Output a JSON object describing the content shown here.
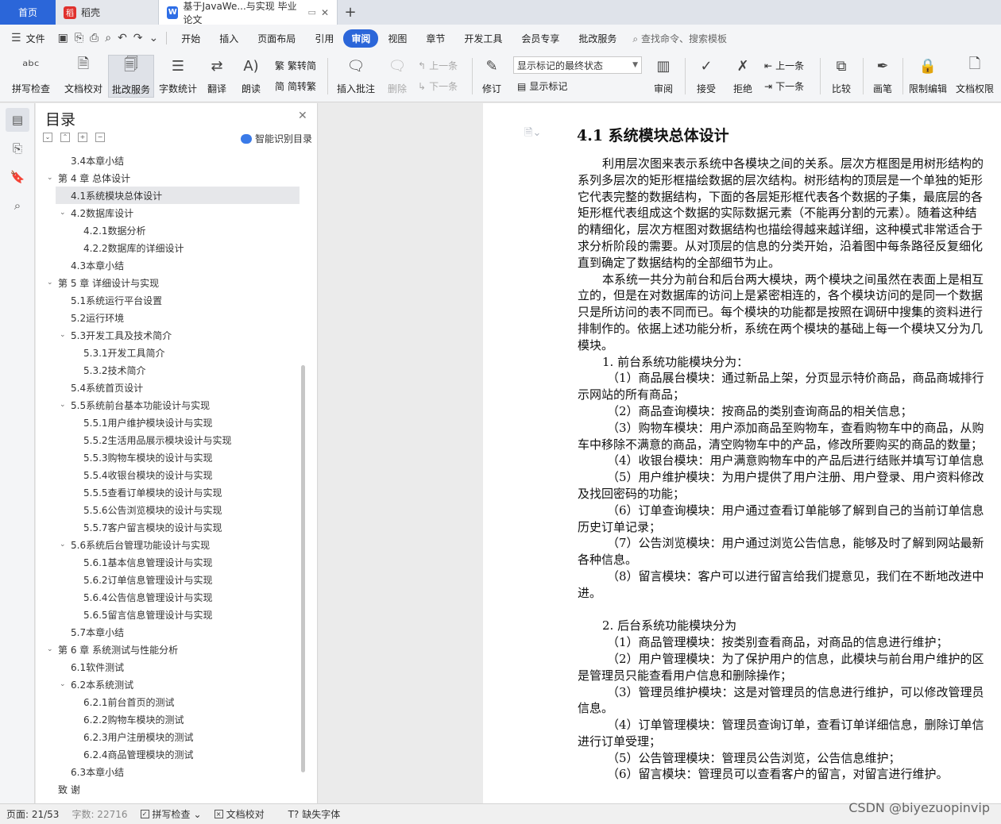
{
  "tabs": {
    "home": "首页",
    "daoke": "稻壳",
    "doc_title": "基于JavaWe...与实现 毕业论文",
    "plus": "+"
  },
  "menu": {
    "file": "文件",
    "items": [
      "开始",
      "插入",
      "页面布局",
      "引用",
      "审阅",
      "视图",
      "章节",
      "开发工具",
      "会员专享",
      "批改服务"
    ],
    "active": "审阅",
    "search": "查找命令、搜索模板"
  },
  "ribbon": {
    "spell_check": "拼写检查",
    "doc_proof": "文档校对",
    "review_service": "批改服务",
    "word_count": "字数统计",
    "translate": "翻译",
    "read_aloud": "朗读",
    "to_traditional": "繁转简",
    "to_simplified": "简转繁",
    "insert_comment": "插入批注",
    "delete": "删除",
    "prev": "上一条",
    "next": "下一条",
    "revise": "修订",
    "markup_select": "显示标记的最终状态",
    "show_markup": "显示标记",
    "review": "审阅",
    "accept": "接受",
    "reject": "拒绝",
    "prev2": "上一条",
    "next2": "下一条",
    "compare": "比较",
    "pen": "画笔",
    "restrict_edit": "限制编辑",
    "doc_permission": "文档权限"
  },
  "toc": {
    "title": "目录",
    "smart": "智能识别目录",
    "items": [
      {
        "text": "3.4本章小结",
        "level": 2,
        "arrow": ""
      },
      {
        "text": "第 4 章    总体设计",
        "level": 1,
        "arrow": "v"
      },
      {
        "text": "4.1系统模块总体设计",
        "level": 2,
        "arrow": "",
        "selected": true
      },
      {
        "text": "4.2数据库设计",
        "level": 2,
        "arrow": "v"
      },
      {
        "text": "4.2.1数据分析",
        "level": 3,
        "arrow": ""
      },
      {
        "text": "4.2.2数据库的详细设计",
        "level": 3,
        "arrow": ""
      },
      {
        "text": "4.3本章小结",
        "level": 2,
        "arrow": ""
      },
      {
        "text": "第 5 章    详细设计与实现",
        "level": 1,
        "arrow": "v"
      },
      {
        "text": "5.1系统运行平台设置",
        "level": 2,
        "arrow": ""
      },
      {
        "text": "5.2运行环境",
        "level": 2,
        "arrow": ""
      },
      {
        "text": "5.3开发工具及技术简介",
        "level": 2,
        "arrow": "v"
      },
      {
        "text": "5.3.1开发工具简介",
        "level": 3,
        "arrow": ""
      },
      {
        "text": "5.3.2技术简介",
        "level": 3,
        "arrow": ""
      },
      {
        "text": "5.4系统首页设计",
        "level": 2,
        "arrow": ""
      },
      {
        "text": "5.5系统前台基本功能设计与实现",
        "level": 2,
        "arrow": "v"
      },
      {
        "text": "5.5.1用户维护模块设计与实现",
        "level": 3,
        "arrow": ""
      },
      {
        "text": "5.5.2生活用品展示模块设计与实现",
        "level": 3,
        "arrow": ""
      },
      {
        "text": "5.5.3购物车模块的设计与实现",
        "level": 3,
        "arrow": ""
      },
      {
        "text": "5.5.4收银台模块的设计与实现",
        "level": 3,
        "arrow": ""
      },
      {
        "text": "5.5.5查看订单模块的设计与实现",
        "level": 3,
        "arrow": ""
      },
      {
        "text": "5.5.6公告浏览模块的设计与实现",
        "level": 3,
        "arrow": ""
      },
      {
        "text": "5.5.7客户留言模块的设计与实现",
        "level": 3,
        "arrow": ""
      },
      {
        "text": "5.6系统后台管理功能设计与实现",
        "level": 2,
        "arrow": "v"
      },
      {
        "text": "5.6.1基本信息管理设计与实现",
        "level": 3,
        "arrow": ""
      },
      {
        "text": "5.6.2订单信息管理设计与实现",
        "level": 3,
        "arrow": ""
      },
      {
        "text": "5.6.4公告信息管理设计与实现",
        "level": 3,
        "arrow": ""
      },
      {
        "text": "5.6.5留言信息管理设计与实现",
        "level": 3,
        "arrow": ""
      },
      {
        "text": "5.7本章小结",
        "level": 2,
        "arrow": ""
      },
      {
        "text": "第 6 章    系统测试与性能分析",
        "level": 1,
        "arrow": "v"
      },
      {
        "text": "6.1软件测试",
        "level": 2,
        "arrow": ""
      },
      {
        "text": "6.2本系统测试",
        "level": 2,
        "arrow": "v"
      },
      {
        "text": "6.2.1前台首页的测试",
        "level": 3,
        "arrow": ""
      },
      {
        "text": "6.2.2购物车模块的测试",
        "level": 3,
        "arrow": ""
      },
      {
        "text": "6.2.3用户注册模块的测试",
        "level": 3,
        "arrow": ""
      },
      {
        "text": "6.2.4商品管理模块的测试",
        "level": 3,
        "arrow": ""
      },
      {
        "text": "6.3本章小结",
        "level": 2,
        "arrow": ""
      },
      {
        "text": "致    谢",
        "level": 1,
        "arrow": ""
      }
    ]
  },
  "document": {
    "heading": "4.1   系统模块总体设计",
    "lines": [
      {
        "t": "利用层次图来表示系统中各模块之间的关系。层次方框图是用树形结构的",
        "indent": 1
      },
      {
        "t": "系列多层次的矩形框描绘数据的层次结构。树形结构的顶层是一个单独的矩形",
        "indent": 0
      },
      {
        "t": "它代表完整的数据结构，下面的各层矩形框代表各个数据的子集，最底层的各",
        "indent": 0
      },
      {
        "t": "矩形框代表组成这个数据的实际数据元素（不能再分割的元素）。随着这种结",
        "indent": 0
      },
      {
        "t": "的精细化，层次方框图对数据结构也描绘得越来越详细，这种模式非常适合于",
        "indent": 0
      },
      {
        "t": "求分析阶段的需要。从对顶层的信息的分类开始，沿着图中每条路径反复细化",
        "indent": 0
      },
      {
        "t": "直到确定了数据结构的全部细节为止。",
        "indent": 0
      },
      {
        "t": "本系统一共分为前台和后台两大模块，两个模块之间虽然在表面上是相互",
        "indent": 1
      },
      {
        "t": "立的，但是在对数据库的访问上是紧密相连的，各个模块访问的是同一个数据",
        "indent": 0
      },
      {
        "t": "只是所访问的表不同而已。每个模块的功能都是按照在调研中搜集的资料进行",
        "indent": 0
      },
      {
        "t": "排制作的。依据上述功能分析，系统在两个模块的基础上每一个模块又分为几",
        "indent": 0
      },
      {
        "t": "模块。",
        "indent": 0
      },
      {
        "t": "1. 前台系统功能模块分为：",
        "indent": 1
      },
      {
        "t": "（1）商品展台模块：通过新品上架，分页显示特价商品，商品商城排行",
        "indent": 2
      },
      {
        "t": "示网站的所有商品；",
        "indent": 0
      },
      {
        "t": "（2）商品查询模块：按商品的类别查询商品的相关信息；",
        "indent": 2
      },
      {
        "t": "（3）购物车模块：用户添加商品至购物车，查看购物车中的商品，从购",
        "indent": 2
      },
      {
        "t": "车中移除不满意的商品，清空购物车中的产品，修改所要购买的商品的数量；",
        "indent": 0
      },
      {
        "t": "（4）收银台模块：用户满意购物车中的产品后进行结账并填写订单信息",
        "indent": 2
      },
      {
        "t": "（5）用户维护模块：为用户提供了用户注册、用户登录、用户资料修改",
        "indent": 2
      },
      {
        "t": "及找回密码的功能；",
        "indent": 0
      },
      {
        "t": "（6）订单查询模块：用户通过查看订单能够了解到自己的当前订单信息",
        "indent": 2
      },
      {
        "t": "历史订单记录；",
        "indent": 0
      },
      {
        "t": "（7）公告浏览模块：用户通过浏览公告信息，能够及时了解到网站最新",
        "indent": 2
      },
      {
        "t": "各种信息。",
        "indent": 0
      },
      {
        "t": "（8）留言模块：客户可以进行留言给我们提意见，我们在不断地改进中",
        "indent": 2
      },
      {
        "t": "进。",
        "indent": 0
      },
      {
        "t": "",
        "indent": 0
      },
      {
        "t": "2. 后台系统功能模块分为",
        "indent": 1
      },
      {
        "t": "（1）商品管理模块：按类别查看商品，对商品的信息进行维护；",
        "indent": 2
      },
      {
        "t": "（2）用户管理模块：为了保护用户的信息，此模块与前台用户维护的区",
        "indent": 2
      },
      {
        "t": "是管理员只能查看用户信息和删除操作；",
        "indent": 0
      },
      {
        "t": "（3）管理员维护模块：这是对管理员的信息进行维护，可以修改管理员",
        "indent": 2
      },
      {
        "t": "信息。",
        "indent": 0
      },
      {
        "t": "（4）订单管理模块：管理员查询订单，查看订单详细信息，删除订单信",
        "indent": 2
      },
      {
        "t": "进行订单受理；",
        "indent": 0
      },
      {
        "t": "（5）公告管理模块：管理员公告浏览，公告信息维护；",
        "indent": 2
      },
      {
        "t": "（6）留言模块：管理员可以查看客户的留言，对留言进行维护。",
        "indent": 2
      }
    ]
  },
  "status": {
    "page": "页面: 21/53",
    "words": "字数: 22716",
    "spell": "拼写检查",
    "proof": "文档校对",
    "missing_font": "缺失字体"
  },
  "watermark": "CSDN @biyezuopinvip"
}
